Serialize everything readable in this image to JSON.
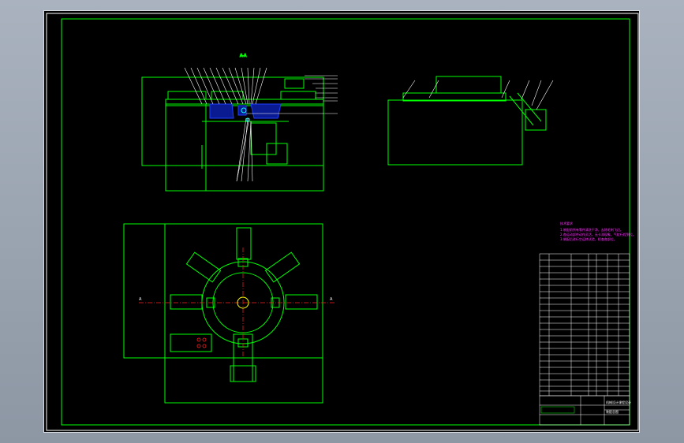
{
  "drawing": {
    "section_label_top": "A-A",
    "section_mark_left": "A",
    "section_mark_right": "A",
    "notes_heading": "技术要求",
    "notes": [
      "1.装配前所有零件清洗干净，去除毛刺飞边。",
      "2.各运动部件动作灵活，无卡滞现象，气缸行程到位。",
      "3.装配后进行空运转试验，检查各部位。"
    ],
    "title_block": {
      "drawing_title": "装配总图",
      "school": "机械设计课程设计"
    },
    "colors": {
      "frame": "#00ff00",
      "dimension": "#ffffff",
      "centerline": "#ff2020",
      "hatch": "#2040ff",
      "notes": "#ff33ff",
      "accent": "#ffff00",
      "cyan": "#00ffff"
    }
  }
}
